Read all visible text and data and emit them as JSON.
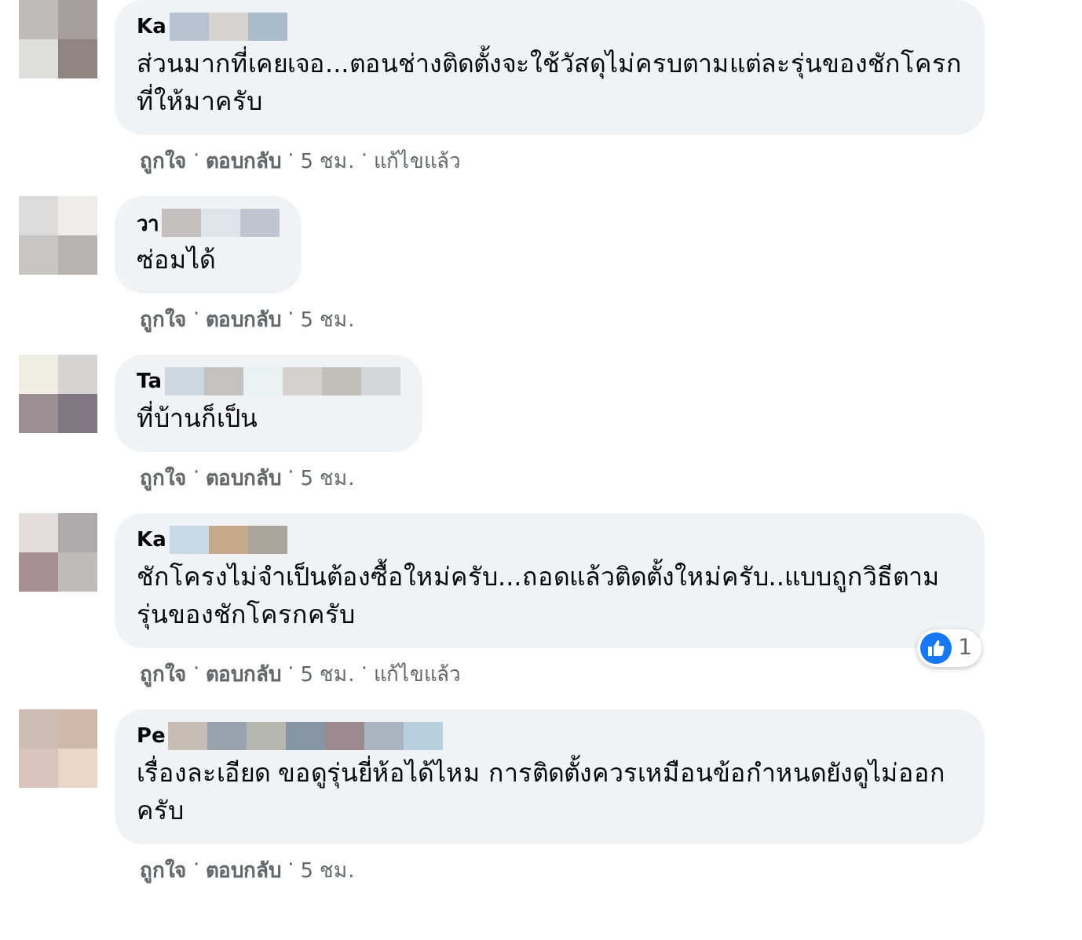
{
  "comments": [
    {
      "author": "Ka",
      "text": "ส่วนมากที่เคยเจอ...ตอนช่างติดตั้งจะใช้วัสดุไม่ครบตามแต่ละรุ่นของชักโครกที่ให้มาครับ",
      "actions": [
        {
          "kind": "like",
          "text": "ถูกใจ"
        },
        {
          "kind": "separator",
          "text": "·"
        },
        {
          "kind": "reply",
          "text": "ตอบกลับ"
        },
        {
          "kind": "separator",
          "text": "·"
        },
        {
          "kind": "time",
          "text": "5 ชม."
        },
        {
          "kind": "separator",
          "text": "·"
        },
        {
          "kind": "edited",
          "text": "แก้ไขแล้ว"
        }
      ]
    },
    {
      "author": "วา",
      "text": "ซ่อมได้",
      "actions": [
        {
          "kind": "like",
          "text": "ถูกใจ"
        },
        {
          "kind": "separator",
          "text": "·"
        },
        {
          "kind": "reply",
          "text": "ตอบกลับ"
        },
        {
          "kind": "separator",
          "text": "·"
        },
        {
          "kind": "time",
          "text": "5 ชม."
        }
      ]
    },
    {
      "author": "Ta",
      "text": "ที่บ้านก็เป็น",
      "actions": [
        {
          "kind": "like",
          "text": "ถูกใจ"
        },
        {
          "kind": "separator",
          "text": "·"
        },
        {
          "kind": "reply",
          "text": "ตอบกลับ"
        },
        {
          "kind": "separator",
          "text": "·"
        },
        {
          "kind": "time",
          "text": "5 ชม."
        }
      ]
    },
    {
      "author": "Ka",
      "text": "ชักโครงไม่จำเป็นต้องซื้อใหม่ครับ...ถอดแล้วติดตั้งใหม่ครับ..แบบถูกวิธีตามรุ่นของชักโครกครับ",
      "actions": [
        {
          "kind": "like",
          "text": "ถูกใจ"
        },
        {
          "kind": "separator",
          "text": "·"
        },
        {
          "kind": "reply",
          "text": "ตอบกลับ"
        },
        {
          "kind": "separator",
          "text": "·"
        },
        {
          "kind": "time",
          "text": "5 ชม."
        },
        {
          "kind": "separator",
          "text": "·"
        },
        {
          "kind": "edited",
          "text": "แก้ไขแล้ว"
        }
      ],
      "reactions": "1"
    },
    {
      "author": "Pe",
      "text": "เรื่องละเอียด ขอดูรุ่นยี่ห้อได้ไหม การติดตั้งควรเหมือนข้อกำหนดยังดูไม่ออกครับ",
      "actions": [
        {
          "kind": "like",
          "text": "ถูกใจ"
        },
        {
          "kind": "separator",
          "text": "·"
        },
        {
          "kind": "reply",
          "text": "ตอบกลับ"
        },
        {
          "kind": "separator",
          "text": "·"
        },
        {
          "kind": "time",
          "text": "5 ชม."
        }
      ]
    }
  ]
}
